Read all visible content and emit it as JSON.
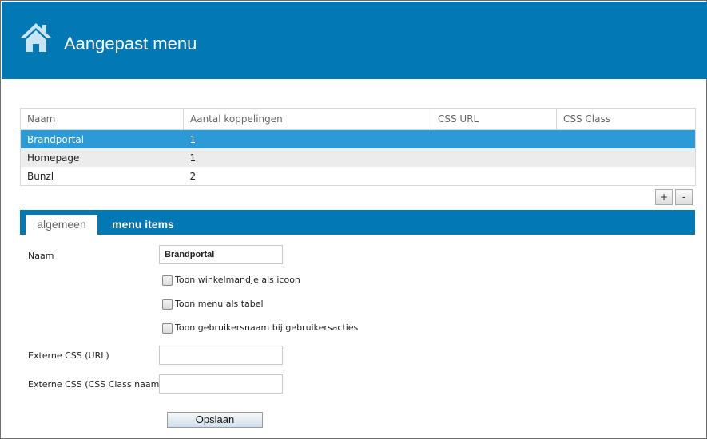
{
  "header": {
    "title": "Aangepast menu",
    "icon": "home-icon",
    "background": "#0278b4"
  },
  "grid": {
    "columns": [
      "Naam",
      "Aantal koppelingen",
      "CSS URL",
      "CSS Class"
    ],
    "rows": [
      [
        "Brandportal",
        "1",
        "",
        ""
      ],
      [
        "Homepage",
        "1",
        "",
        ""
      ],
      [
        "Bunzl",
        "2",
        "",
        ""
      ]
    ],
    "selected_row": 0,
    "selected_color": "#2b9ad7",
    "add_label": "+",
    "remove_label": "-"
  },
  "tabs": [
    {
      "label": "algemeen",
      "active": true
    },
    {
      "label": "menu items",
      "active": false
    }
  ],
  "form": {
    "name_label": "Naam",
    "name_value": "Brandportal",
    "checkboxes": [
      {
        "label": "Toon winkelmandje als icoon",
        "checked": false
      },
      {
        "label": "Toon menu als tabel",
        "checked": false
      },
      {
        "label": "Toon gebruikersnaam bij gebruikersacties",
        "checked": false
      }
    ],
    "css_url_label": "Externe CSS (URL)",
    "css_url_value": "",
    "css_class_label": "Externe CSS (CSS Class naam)",
    "css_class_value": "",
    "save_label": "Opslaan"
  }
}
